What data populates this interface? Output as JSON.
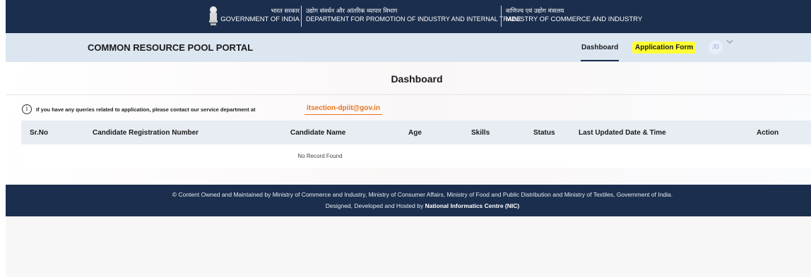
{
  "gov_banner": {
    "hindi_gov": "भारत सरकार",
    "gov_of_india": "GOVERNMENT OF INDIA",
    "dept_hindi": "उद्योग संवर्धन और आंतरिक व्यापार विभाग",
    "dept_english": "DEPARTMENT FOR PROMOTION OF INDUSTRY AND INTERNAL TRADE",
    "ministry_hindi": "वाणिज्य एवं उद्योग मंत्रालय",
    "ministry_english": "MINISTRY OF COMMERCE AND INDUSTRY",
    "emblem_icon": "national-emblem-icon"
  },
  "portal": {
    "title": "COMMON RESOURCE POOL PORTAL",
    "nav_dashboard": "Dashboard",
    "nav_application_form": "Application Form",
    "avatar_initials": "JD",
    "dropdown_icon": "chevron-down-icon"
  },
  "main": {
    "page_title": "Dashboard",
    "info_icon": "info-icon",
    "info_text": "If you have any queries related to application, please contact our service department at",
    "contact_email": "itsection-dpiit@gov.in"
  },
  "table": {
    "columns": [
      "Sr.No",
      "Candidate Registration Number",
      "Candidate Name",
      "Age",
      "Skills",
      "Status",
      "Last Updated Date & Time",
      "Action"
    ],
    "empty_message": "No Record Found"
  },
  "footer": {
    "line1": "© Content Owned and Maintained by Ministry of Commerce and Industry, Ministry of Consumer Affairs, Ministry of Food and Public Distribution and Ministry of Textiles, Government of India.",
    "line2_prefix": "Designed, Developed and Hosted by",
    "line2_org": "National Informatics Centre (NIC)"
  },
  "colors": {
    "banner_navy": "#1b2e4d",
    "nav_bg": "#dce6f1",
    "highlight_yellow": "#ffff33",
    "email_orange": "#e8741b",
    "table_header_bg": "#e8edf4"
  }
}
